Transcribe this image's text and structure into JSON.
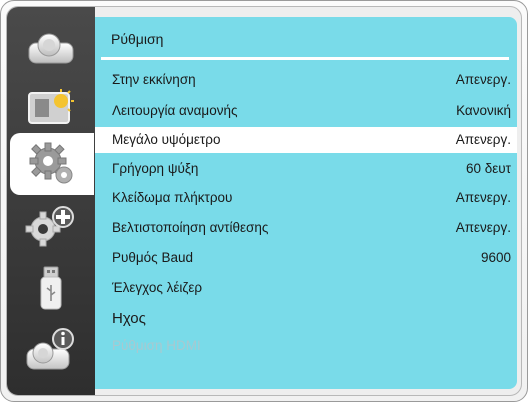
{
  "menu": {
    "title": "Ρύθμιση",
    "items": [
      {
        "label": "Στην εκκίνηση",
        "value": "Απενεργ."
      },
      {
        "label": "Λειτουργία αναμονής",
        "value": "Κανονική"
      },
      {
        "label": "Μεγάλο υψόμετρο",
        "value": "Απενεργ."
      },
      {
        "label": "Γρήγορη ψύξη",
        "value": "60 δευτ"
      },
      {
        "label": "Κλείδωμα πλήκτρου",
        "value": "Απενεργ."
      },
      {
        "label": "Βελτιστοποίηση αντίθεσης",
        "value": "Απενεργ."
      },
      {
        "label": "Ρυθμός Baud",
        "value": "9600"
      },
      {
        "label": "Έλεγχος λέιζερ",
        "value": ""
      },
      {
        "label": "Ηχος",
        "value": ""
      },
      {
        "label": "Ρύθμιση HDMI",
        "value": ""
      }
    ],
    "selected_index": 2,
    "disabled_index": 9
  },
  "sidebar": {
    "items": [
      {
        "icon": "projector-icon"
      },
      {
        "icon": "picture-adjust-icon"
      },
      {
        "icon": "gear-icon"
      },
      {
        "icon": "gears-plus-icon"
      },
      {
        "icon": "usb-icon"
      },
      {
        "icon": "projector-info-icon"
      }
    ],
    "active_index": 2
  },
  "colors": {
    "panel": "#79dbe9",
    "sidebar": "#3a3a3a",
    "selected_row": "#ffffff",
    "disabled_text": "#a8c9d0"
  }
}
